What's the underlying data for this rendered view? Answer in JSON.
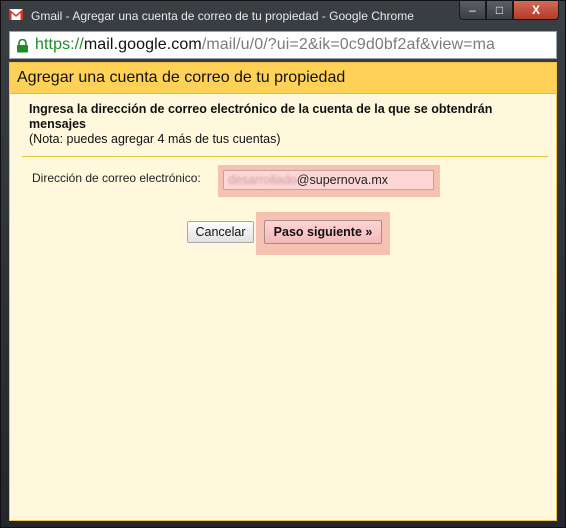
{
  "window": {
    "title": "Gmail - Agregar una cuenta de correo de tu propiedad - Google Chrome",
    "controls": {
      "minimize": "–",
      "maximize": "□",
      "close": "X"
    }
  },
  "address_bar": {
    "scheme": "https://",
    "host": "mail.google.com",
    "path": "/mail/u/0/?ui=2&ik=0c9d0bf2af&view=ma",
    "lock_icon": "lock-icon"
  },
  "dialog": {
    "title": "Agregar una cuenta de correo de tu propiedad",
    "instruction": "Ingresa la dirección de correo electrónico de la cuenta de la que se obtendrán mensajes",
    "note": "(Nota: puedes agregar 4 más de tus cuentas)",
    "email_label": "Dirección de correo electrónico:",
    "email_user": "desarrollado",
    "email_domain": "@supernova.mx",
    "cancel_label": "Cancelar",
    "next_label": "Paso siguiente »"
  },
  "colors": {
    "header_bg": "#ffd257",
    "content_bg": "#fff8dd",
    "highlight": "#f5c2b2",
    "url_green": "#1e8a28"
  }
}
